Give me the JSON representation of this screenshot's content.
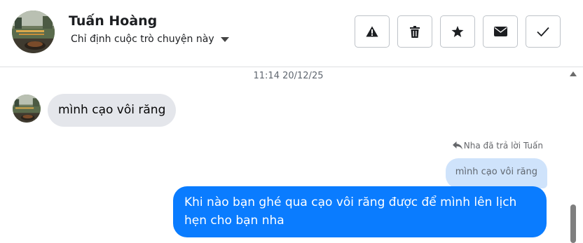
{
  "header": {
    "contact_name": "Tuấn Hoàng",
    "assign_label": "Chỉ định cuộc trò chuyện này",
    "actions": [
      {
        "name": "report-button",
        "icon": "warning-icon"
      },
      {
        "name": "delete-button",
        "icon": "trash-icon"
      },
      {
        "name": "star-button",
        "icon": "star-icon"
      },
      {
        "name": "mark-unread-button",
        "icon": "envelope-icon"
      },
      {
        "name": "mark-done-button",
        "icon": "check-icon"
      }
    ]
  },
  "thread": {
    "timestamp": "11:14 20/12/25",
    "incoming": {
      "text": "mình cạo vôi răng"
    },
    "reply_label": "Nha đã trả lời Tuấn",
    "quoted_text": "mình cạo vôi răng",
    "outgoing": {
      "text": "Khi nào bạn ghé qua cạo vôi răng được để mình lên lịch hẹn cho bạn nha"
    }
  },
  "colors": {
    "outgoing_bubble": "#0a7cff",
    "incoming_bubble": "#e4e6eb",
    "quoted_bubble": "#cfe3fb"
  }
}
